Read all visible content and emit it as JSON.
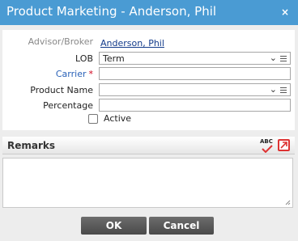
{
  "dialog": {
    "title": "Product Marketing - Anderson, Phil",
    "close_label": "×"
  },
  "form": {
    "advisor_label": "Advisor/Broker",
    "advisor_value": "Anderson, Phil",
    "lob_label": "LOB",
    "lob_value": "Term",
    "carrier_label": "Carrier",
    "carrier_required_mark": "*",
    "carrier_value": "",
    "product_label": "Product Name",
    "product_value": "",
    "percentage_label": "Percentage",
    "percentage_value": "",
    "active_label": "Active",
    "active_checked": false
  },
  "remarks": {
    "title": "Remarks",
    "spellcheck_text": "ABC",
    "value": ""
  },
  "buttons": {
    "ok": "OK",
    "cancel": "Cancel"
  },
  "colors": {
    "titlebar": "#4a9bd3",
    "required": "#d0021b",
    "carrier_label": "#2a62b8"
  }
}
